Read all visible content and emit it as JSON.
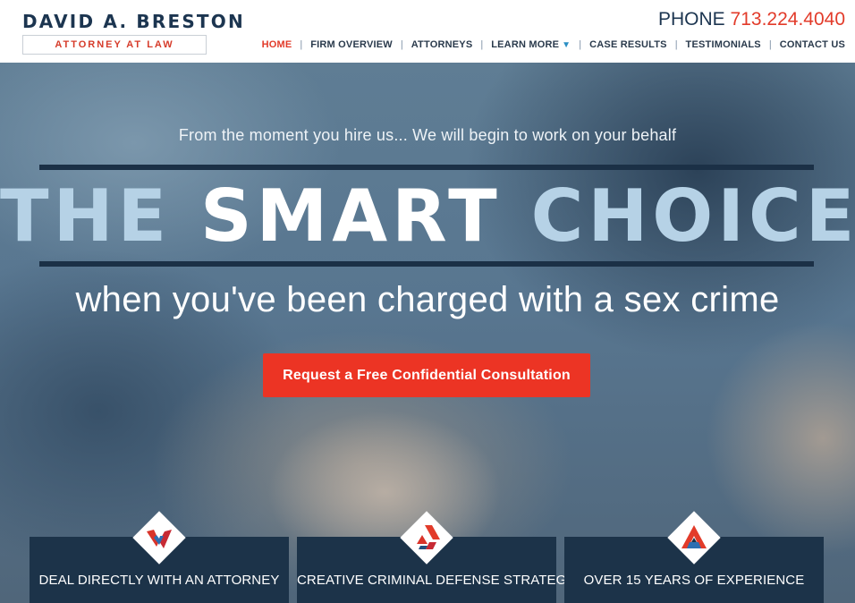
{
  "colors": {
    "accent": "#e23b2a",
    "navy": "#1c3349",
    "light_blue": "#b6d2e6"
  },
  "header": {
    "logo_name": "DAVID A. BRESTON",
    "logo_subtitle": "ATTORNEY AT LAW",
    "phone_label": "PHONE",
    "phone_number": "713.224.4040"
  },
  "nav": {
    "items": [
      {
        "label": "HOME",
        "active": true
      },
      {
        "label": "FIRM OVERVIEW"
      },
      {
        "label": "ATTORNEYS"
      },
      {
        "label": "LEARN MORE",
        "icon": "caret-down-icon"
      },
      {
        "label": "CASE RESULTS"
      },
      {
        "label": "TESTIMONIALS"
      },
      {
        "label": "CONTACT US"
      }
    ],
    "separator": "|",
    "caret": "▼"
  },
  "hero": {
    "tagline": "From the moment you hire us... We will begin to work on your behalf",
    "headline": [
      "THE",
      "SMART",
      "CHOICE"
    ],
    "subhead": "when you've been charged with a sex crime",
    "cta_label": "Request a Free Confidential Consultation"
  },
  "features": [
    {
      "label": "DEAL DIRECTLY WITH AN ATTORNEY",
      "icon": "attorney-diamond-icon"
    },
    {
      "label": "CREATIVE CRIMINAL DEFENSE STRATEGIES",
      "icon": "strategy-diamond-icon"
    },
    {
      "label": "OVER 15 YEARS OF EXPERIENCE",
      "icon": "experience-diamond-icon"
    }
  ]
}
